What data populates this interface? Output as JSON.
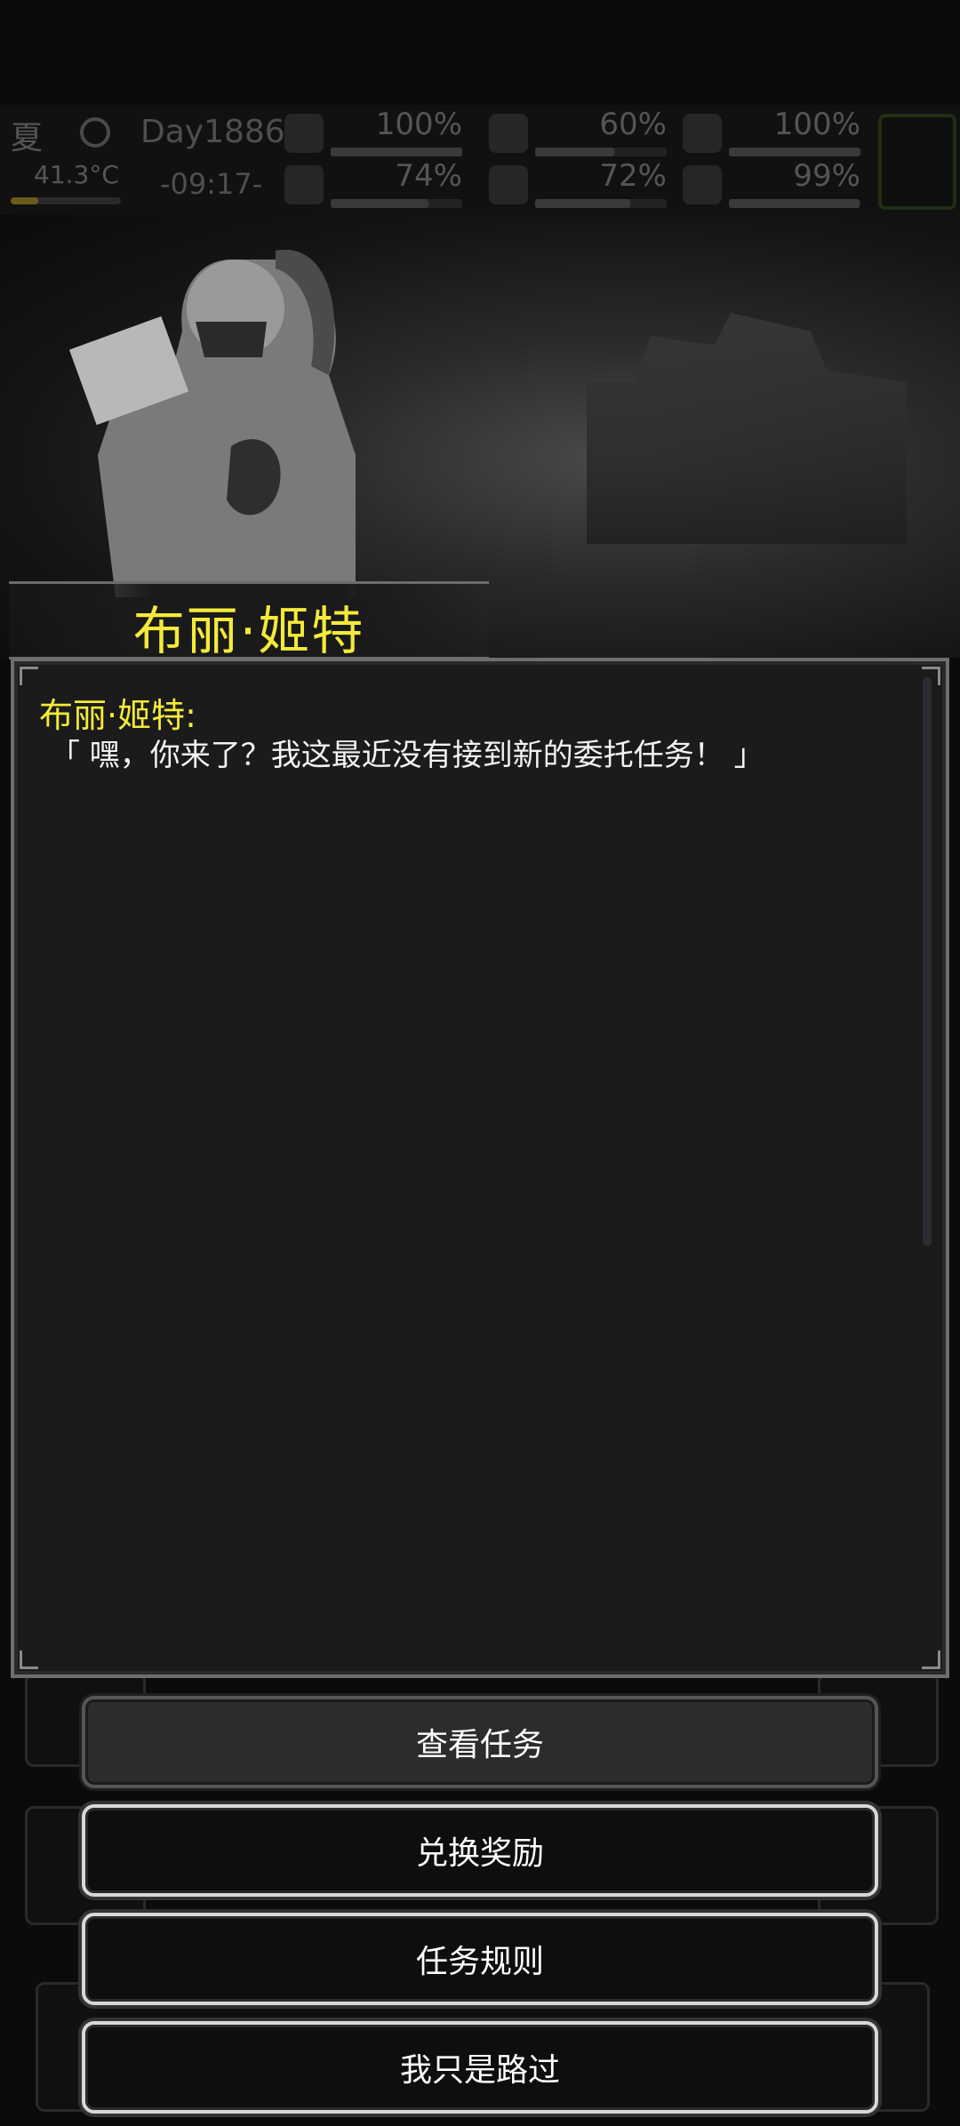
{
  "hud": {
    "season": "夏",
    "temperature": "41.3°C",
    "temperature_level": 0.25,
    "day": "Day1886",
    "clock": "-09:17-",
    "stats": [
      {
        "icon": "medkit-icon",
        "value": "100%",
        "level": 1.0
      },
      {
        "icon": "stomach-icon",
        "value": "60%",
        "level": 0.6
      },
      {
        "icon": "pill-icon",
        "value": "100%",
        "level": 1.0
      },
      {
        "icon": "flask-icon",
        "value": "74%",
        "level": 0.74
      },
      {
        "icon": "water-drop-icon",
        "value": "72%",
        "level": 0.72
      },
      {
        "icon": "heart-icon",
        "value": "99%",
        "level": 0.99
      }
    ]
  },
  "npc": {
    "name": "布丽·姬特"
  },
  "dialog": {
    "speaker": "布丽·姬特:",
    "text": "「 嘿，你来了？我这最近没有接到新的委托任务！ 」"
  },
  "options": [
    {
      "label": "查看任务",
      "style": "primary"
    },
    {
      "label": "兑换奖励",
      "style": "secondary"
    },
    {
      "label": "任务规则",
      "style": "secondary"
    },
    {
      "label": "我只是路过",
      "style": "secondary"
    }
  ],
  "colors": {
    "name_yellow": "#f4ea3a",
    "dialog_bg": "#1b1b1b",
    "button_border": "#d8d8d8"
  }
}
